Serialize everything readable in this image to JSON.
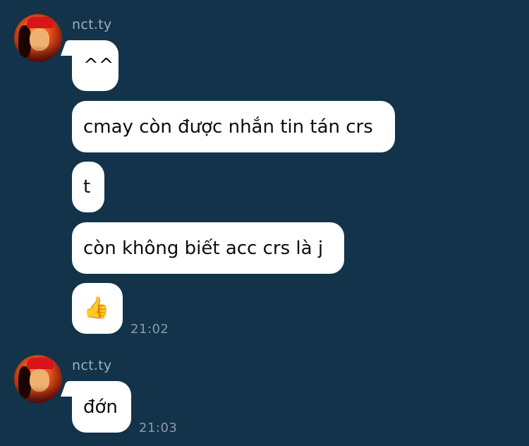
{
  "groups": [
    {
      "sender": "nct.ty",
      "messages": [
        "^^",
        "cmay còn được nhắn tin tán crs",
        "t",
        "còn không biết acc crs là j",
        "👍"
      ],
      "time": "21:02"
    },
    {
      "sender": "nct.ty",
      "messages": [
        "đớn"
      ],
      "time": "21:03"
    }
  ],
  "colors": {
    "background": "#12334a",
    "bubble": "#ffffff",
    "sender_name": "#9fb0bd",
    "timestamp": "#8a9cab"
  }
}
